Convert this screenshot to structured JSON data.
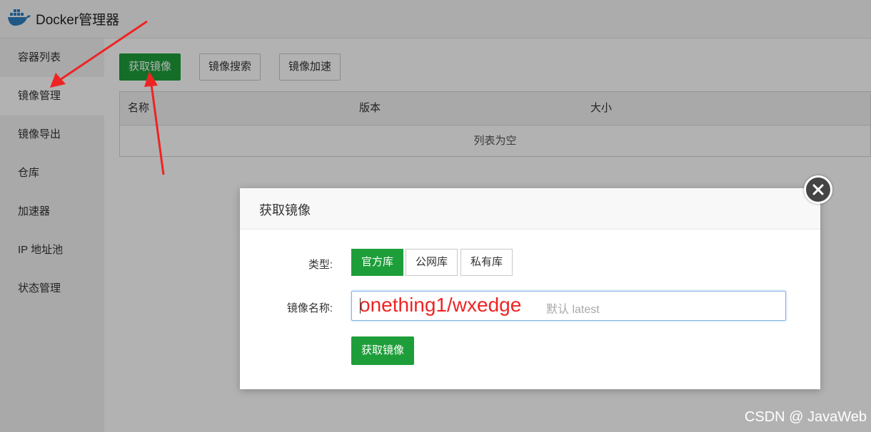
{
  "app": {
    "title": "Docker管理器",
    "logo_icon": "docker-whale-icon"
  },
  "sidebar": {
    "items": [
      {
        "label": "容器列表",
        "active": false
      },
      {
        "label": "镜像管理",
        "active": true
      },
      {
        "label": "镜像导出",
        "active": false
      },
      {
        "label": "仓库",
        "active": false
      },
      {
        "label": "加速器",
        "active": false
      },
      {
        "label": "IP 地址池",
        "active": false
      },
      {
        "label": "状态管理",
        "active": false
      }
    ]
  },
  "toolbar": {
    "pull_label": "获取镜像",
    "search_label": "镜像搜索",
    "accelerate_label": "镜像加速"
  },
  "table": {
    "columns": [
      "名称",
      "版本",
      "大小"
    ],
    "empty_text": "列表为空"
  },
  "dialog": {
    "title": "获取镜像",
    "type_label": "类型:",
    "type_options": [
      "官方库",
      "公网库",
      "私有库"
    ],
    "selected_type": "官方库",
    "name_label": "镜像名称:",
    "name_placeholder_visible": "默认 latest",
    "name_annotation": "onething1/wxedge",
    "submit_label": "获取镜像",
    "close_icon": "close-icon"
  },
  "watermark": "CSDN @ JavaWeb",
  "colors": {
    "primary_green": "#1e9e3a",
    "annotation_red": "#ee2424",
    "overlay": "rgba(0,0,0,0.30)"
  }
}
